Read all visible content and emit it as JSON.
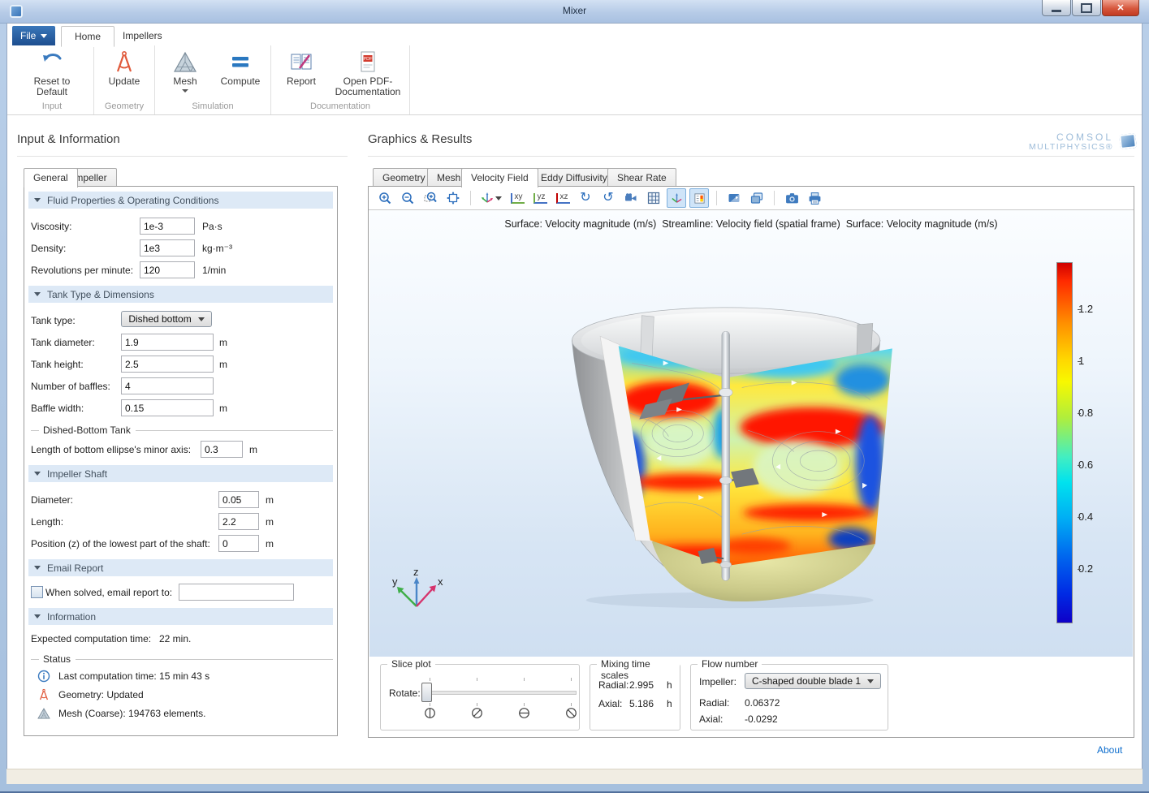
{
  "window": {
    "title": "Mixer",
    "buttons": [
      "minimize",
      "maximize",
      "close"
    ]
  },
  "colors": {
    "accent_blue": "#2a6dbc",
    "file_button_blue": "#1d4e8f",
    "section_header_bg": "#dde9f6",
    "toggle_active_bg": "#cfe4f8",
    "link_blue": "#0e6ecd",
    "canvas_top": "#fbfdff",
    "canvas_bottom": "#cfdff1",
    "colorbar_top": "#cf0000",
    "colorbar_bottom": "#0e00c8"
  },
  "ribbon": {
    "file_label": "File",
    "tabs": [
      {
        "label": "Home",
        "active": true
      },
      {
        "label": "Impellers",
        "active": false
      }
    ],
    "groups": [
      {
        "label": "Input",
        "buttons": [
          {
            "label": "Reset to Default",
            "icon": "undo-icon"
          }
        ]
      },
      {
        "label": "Geometry",
        "buttons": [
          {
            "label": "Update",
            "icon": "compass-icon"
          }
        ]
      },
      {
        "label": "Simulation",
        "buttons": [
          {
            "label": "Mesh",
            "icon": "mesh-icon",
            "dropdown": true
          },
          {
            "label": "Compute",
            "icon": "equals-icon"
          }
        ]
      },
      {
        "label": "Documentation",
        "buttons": [
          {
            "label": "Report",
            "icon": "report-icon"
          },
          {
            "label": "Open PDF-Documentation",
            "icon": "pdf-icon"
          }
        ]
      }
    ]
  },
  "left": {
    "title": "Input & Information",
    "tabs": [
      "General",
      "Impeller"
    ],
    "fluid": {
      "title": "Fluid Properties & Operating Conditions",
      "rows": [
        {
          "label": "Viscosity:",
          "value": "1e-3",
          "unit": "Pa·s"
        },
        {
          "label": "Density:",
          "value": "1e3",
          "unit": "kg·m⁻³"
        },
        {
          "label": "Revolutions per minute:",
          "value": "120",
          "unit": "1/min"
        }
      ]
    },
    "tank": {
      "title": "Tank Type & Dimensions",
      "type_label": "Tank type:",
      "type_value": "Dished bottom",
      "rows": [
        {
          "label": "Tank diameter:",
          "value": "1.9",
          "unit": "m"
        },
        {
          "label": "Tank height:",
          "value": "2.5",
          "unit": "m"
        },
        {
          "label": "Number of baffles:",
          "value": "4",
          "unit": ""
        },
        {
          "label": "Baffle width:",
          "value": "0.15",
          "unit": "m"
        }
      ],
      "dished": {
        "title": "Dished-Bottom Tank",
        "label": "Length of bottom ellipse's minor axis:",
        "value": "0.3",
        "unit": "m"
      }
    },
    "shaft": {
      "title": "Impeller Shaft",
      "rows": [
        {
          "label": "Diameter:",
          "value": "0.05",
          "unit": "m"
        },
        {
          "label": "Length:",
          "value": "2.2",
          "unit": "m"
        },
        {
          "label": "Position (z) of the lowest part of the shaft:",
          "value": "0",
          "unit": "m"
        }
      ]
    },
    "email": {
      "title": "Email Report",
      "checkbox_label": "When solved, email report to:",
      "checkbox_checked": false,
      "value": ""
    },
    "info": {
      "title": "Information",
      "expected_label": "Expected computation time:",
      "expected_value": "22 min.",
      "status": {
        "title": "Status",
        "items": [
          {
            "icon": "info-icon",
            "text": "Last computation time: 15 min 43 s"
          },
          {
            "icon": "compass-icon",
            "text": "Geometry: Updated"
          },
          {
            "icon": "mesh-icon",
            "text": "Mesh (Coarse): 194763 elements."
          }
        ]
      }
    }
  },
  "right": {
    "title": "Graphics & Results",
    "logo_line1": "COMSOL",
    "logo_line2": "MULTIPHYSICS®",
    "tabs": [
      {
        "label": "Geometry",
        "active": false
      },
      {
        "label": "Mesh",
        "active": false
      },
      {
        "label": "Velocity Field",
        "active": true
      },
      {
        "label": "Eddy Diffusivity",
        "active": false
      },
      {
        "label": "Shear Rate",
        "active": false
      }
    ],
    "toolbar_icons": [
      "zoom-in",
      "zoom-out",
      "zoom-box",
      "zoom-extents",
      "view-orientation",
      "caret-down",
      "view-xy",
      "view-yz",
      "view-xz",
      "rotate-left",
      "rotate-right",
      "scene-camera",
      "grid",
      "axes-toggle",
      "color-legend-toggle",
      "transparency",
      "environment",
      "snapshot",
      "print"
    ],
    "plot": {
      "title": "Surface: Velocity magnitude (m/s)  Streamline: Velocity field (spatial frame)  Surface: Velocity magnitude (m/s)",
      "colorbar_ticks": [
        "1.2",
        "1",
        "0.8",
        "0.6",
        "0.4",
        "0.2"
      ],
      "axis_labels": {
        "x": "x",
        "y": "y",
        "z": "z"
      }
    },
    "slice": {
      "title": "Slice plot",
      "rotate_label": "Rotate:",
      "orientation_icons": [
        "slice-vertical",
        "slice-diagonal",
        "slice-horizontal",
        "slice-antidiagonal"
      ]
    },
    "mixing": {
      "title": "Mixing time scales",
      "rows": [
        {
          "label": "Radial:",
          "value": "2.995",
          "unit": "h"
        },
        {
          "label": "Axial:",
          "value": "5.186",
          "unit": "h"
        }
      ]
    },
    "flow": {
      "title": "Flow number",
      "impeller_label": "Impeller:",
      "impeller_value": "C-shaped double blade 1",
      "rows": [
        {
          "label": "Radial:",
          "value": "0.06372"
        },
        {
          "label": "Axial:",
          "value": "-0.0292"
        }
      ]
    },
    "about": "About"
  }
}
